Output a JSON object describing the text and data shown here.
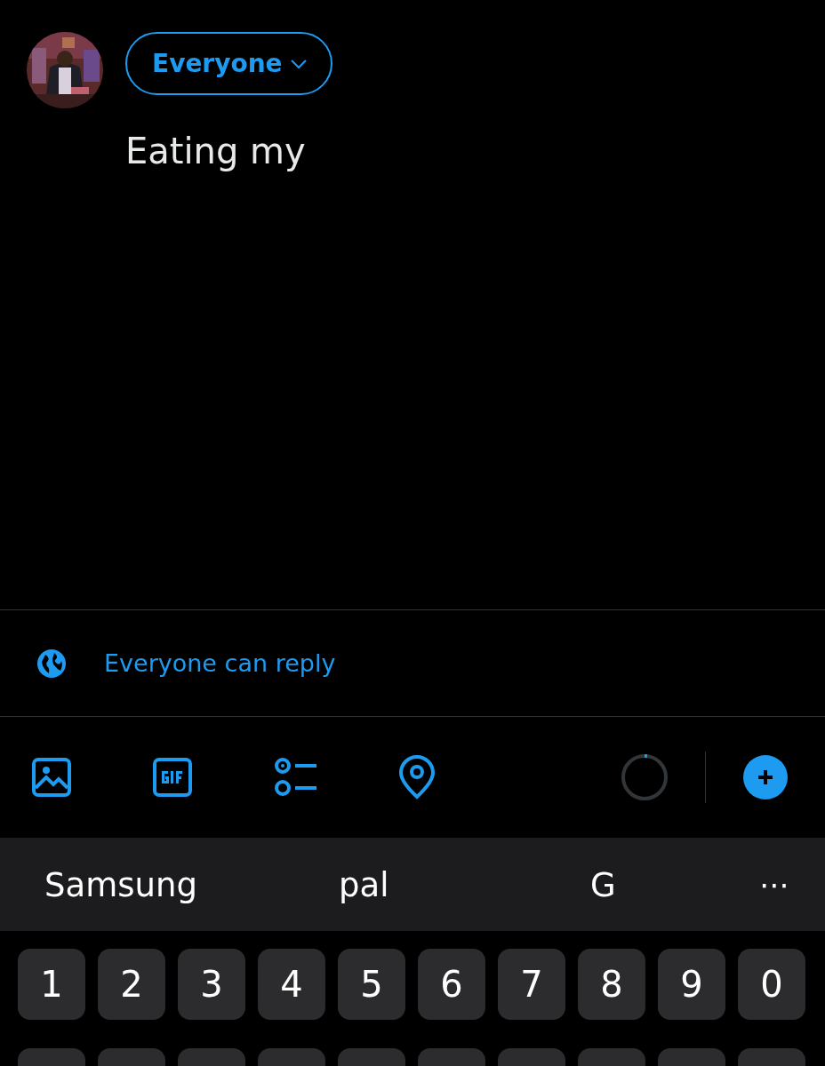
{
  "audience_button": {
    "label": "Everyone"
  },
  "post_text": "Eating my",
  "reply_setting": {
    "label": "Everyone can reply"
  },
  "toolbar": {
    "char_counter": {
      "level": 0.02
    }
  },
  "suggestions": [
    "Samsung",
    "pal",
    "G"
  ],
  "suggestions_more": "⋯",
  "number_keys": [
    "1",
    "2",
    "3",
    "4",
    "5",
    "6",
    "7",
    "8",
    "9",
    "0"
  ]
}
